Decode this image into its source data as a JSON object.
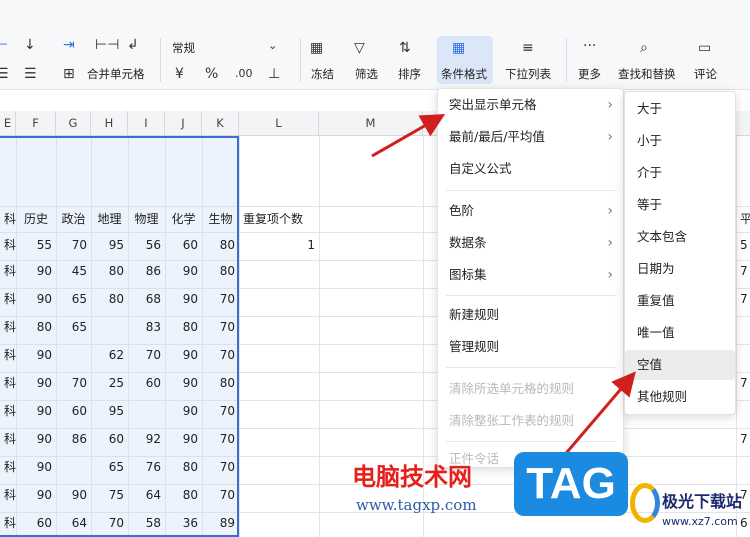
{
  "toolbar": {
    "font_select": "常规",
    "merge_label": "合并单元格",
    "currency_icon": "¥",
    "percent_icon": "%",
    "freeze": "冻结",
    "filter": "筛选",
    "sort": "排序",
    "conditional_format": "条件格式",
    "dropdown_list": "下拉列表",
    "more": "更多",
    "find_replace": "查找和替换",
    "comment": "评论"
  },
  "columns": [
    "E",
    "F",
    "G",
    "H",
    "I",
    "J",
    "K",
    "L",
    "M"
  ],
  "header_row": [
    "科",
    "历史",
    "政治",
    "地理",
    "物理",
    "化学",
    "生物",
    "重复项个数",
    "",
    "平"
  ],
  "rows": [
    [
      "科",
      "55",
      "70",
      "95",
      "56",
      "60",
      "80",
      "1",
      "",
      "5"
    ],
    [
      "科",
      "90",
      "45",
      "80",
      "86",
      "90",
      "80",
      "",
      "",
      "7"
    ],
    [
      "科",
      "90",
      "65",
      "80",
      "68",
      "90",
      "70",
      "",
      "",
      "7"
    ],
    [
      "科",
      "80",
      "65",
      "",
      "83",
      "80",
      "70",
      "",
      "",
      ""
    ],
    [
      "科",
      "90",
      "",
      "62",
      "70",
      "90",
      "70",
      "",
      "",
      ""
    ],
    [
      "科",
      "90",
      "70",
      "25",
      "60",
      "90",
      "80",
      "",
      "",
      "7"
    ],
    [
      "科",
      "90",
      "60",
      "95",
      "",
      "90",
      "70",
      "",
      "",
      ""
    ],
    [
      "科",
      "90",
      "86",
      "60",
      "92",
      "90",
      "70",
      "",
      "",
      "7"
    ],
    [
      "科",
      "90",
      "",
      "65",
      "76",
      "80",
      "70",
      "",
      "",
      ""
    ],
    [
      "科",
      "90",
      "90",
      "75",
      "64",
      "80",
      "70",
      "",
      "",
      "7"
    ],
    [
      "科",
      "60",
      "64",
      "70",
      "58",
      "36",
      "89",
      "",
      "",
      "6"
    ]
  ],
  "menu": {
    "items": [
      "突出显示单元格",
      "最前/最后/平均值",
      "自定义公式",
      "色阶",
      "数据条",
      "图标集",
      "新建规则",
      "管理规则",
      "清除所选单元格的规则",
      "清除整张工作表的规则",
      "正件令话"
    ]
  },
  "submenu": {
    "items": [
      "大于",
      "小于",
      "介于",
      "等于",
      "文本包含",
      "日期为",
      "重复值",
      "唯一值",
      "空值",
      "其他规则"
    ]
  },
  "watermark": {
    "line1": "电脑技术网",
    "line2": "www.tagxp.com",
    "tag": "TAG",
    "site1": "极光下载站",
    "site2": "www.xz7.com"
  },
  "colors": {
    "accent": "#3a6fd0",
    "arrow": "#d01f1f"
  }
}
